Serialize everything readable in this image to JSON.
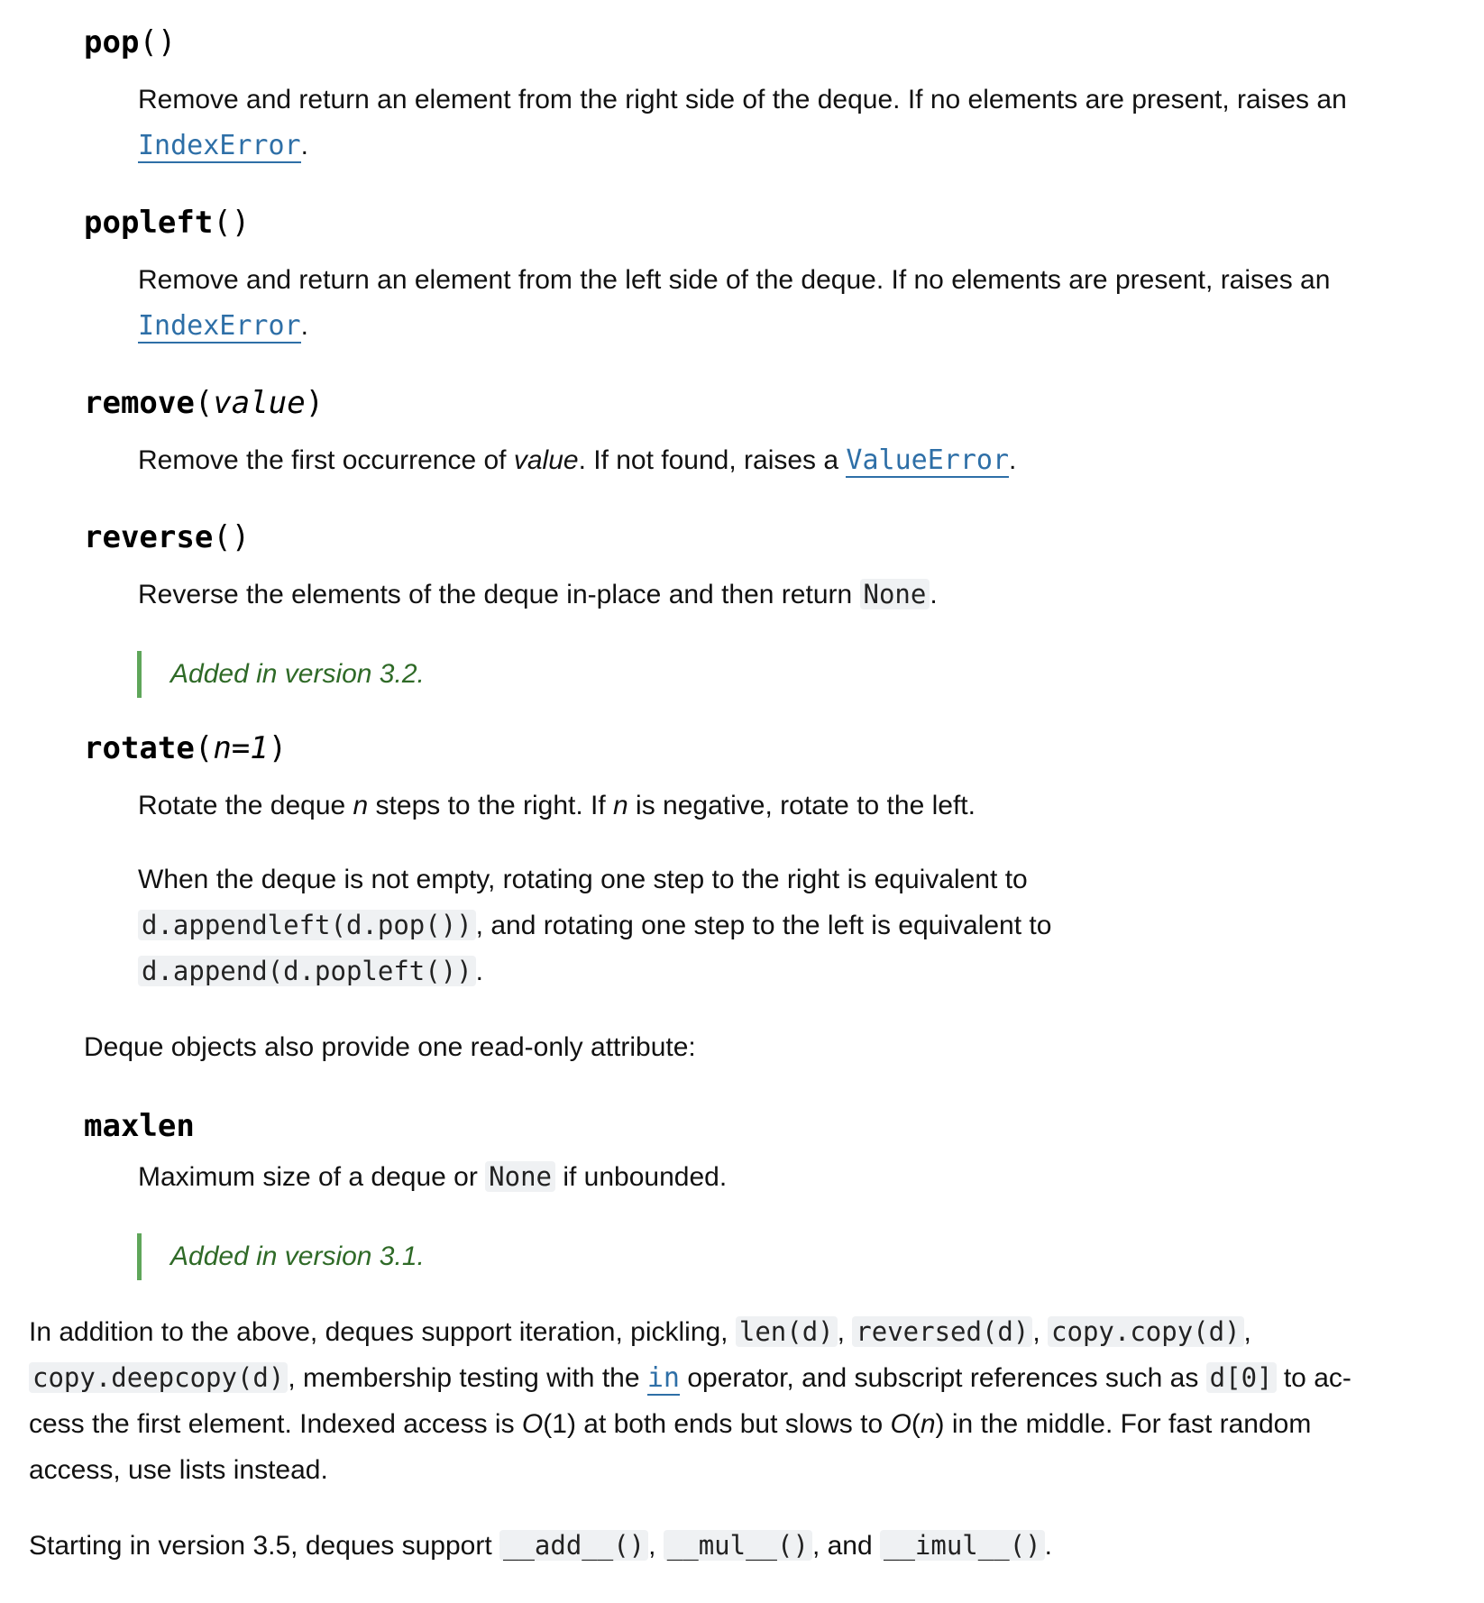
{
  "pop": {
    "name": "pop",
    "params": "()",
    "desc_before": "Remove and return an element from the right side of the deque. If no elements are present, raises an",
    "error_link": "IndexError",
    "desc_after": "."
  },
  "popleft": {
    "name": "popleft",
    "params": "()",
    "desc_before": "Remove and return an element from the left side of the deque. If no elements are present, raises an",
    "error_link": "IndexError",
    "desc_after": "."
  },
  "remove": {
    "name": "remove",
    "open_paren": "(",
    "arg": "value",
    "close_paren": ")",
    "desc_1": "Remove the first occurrence of ",
    "desc_arg": "value",
    "desc_2": ". If not found, raises a ",
    "error_link": "ValueError",
    "desc_3": "."
  },
  "reverse": {
    "name": "reverse",
    "params": "()",
    "desc_1": "Reverse the elements of the deque in-place and then return ",
    "code": "None",
    "desc_2": ".",
    "version_note": "Added in version 3.2."
  },
  "rotate": {
    "name": "rotate",
    "open_paren": "(",
    "arg": "n=1",
    "close_paren": ")",
    "p1_a": "Rotate the deque ",
    "p1_n1": "n",
    "p1_b": " steps to the right. If ",
    "p1_n2": "n",
    "p1_c": " is negative, rotate to the left.",
    "p2_line1": "When the deque is not empty, rotating one step to the right is equivalent to",
    "p2_code1": "d.appendleft(d.pop())",
    "p2_mid": ", and rotating one step to the left is equivalent to",
    "p2_code2": "d.append(d.popleft())",
    "p2_end": "."
  },
  "attr_intro": "Deque objects also provide one read-only attribute:",
  "maxlen": {
    "name": "maxlen",
    "desc_1": "Maximum size of a deque or ",
    "code": "None",
    "desc_2": " if unbounded.",
    "version_note": "Added in version 3.1."
  },
  "summary": {
    "l1_a": "In addition to the above, deques support iteration, pickling, ",
    "c_len": "len(d)",
    "sep1": ", ",
    "c_reversed": "reversed(d)",
    "sep2": ", ",
    "c_copy": "copy.copy(d)",
    "sep3": ",",
    "c_deepcopy": "copy.deepcopy(d)",
    "l2_a": ", membership testing with the ",
    "in_link": "in",
    "l2_b": " operator, and subscript references such as ",
    "c_index": "d[0]",
    "l2_c": " to ac-",
    "l3_a": "cess the first element. Indexed access is ",
    "o1": "O",
    "l3_b": "(1) at both ends but slows to ",
    "o2": "O",
    "l3_c": "(",
    "n": "n",
    "l3_d": ") in the middle. For fast random",
    "l4": "access, use lists instead."
  },
  "starting": {
    "a": "Starting in version 3.5, deques support ",
    "add": "__add__()",
    "sep1": ", ",
    "mul": "__mul__()",
    "sep2": ", and ",
    "imul": "__imul__()",
    "end": "."
  }
}
